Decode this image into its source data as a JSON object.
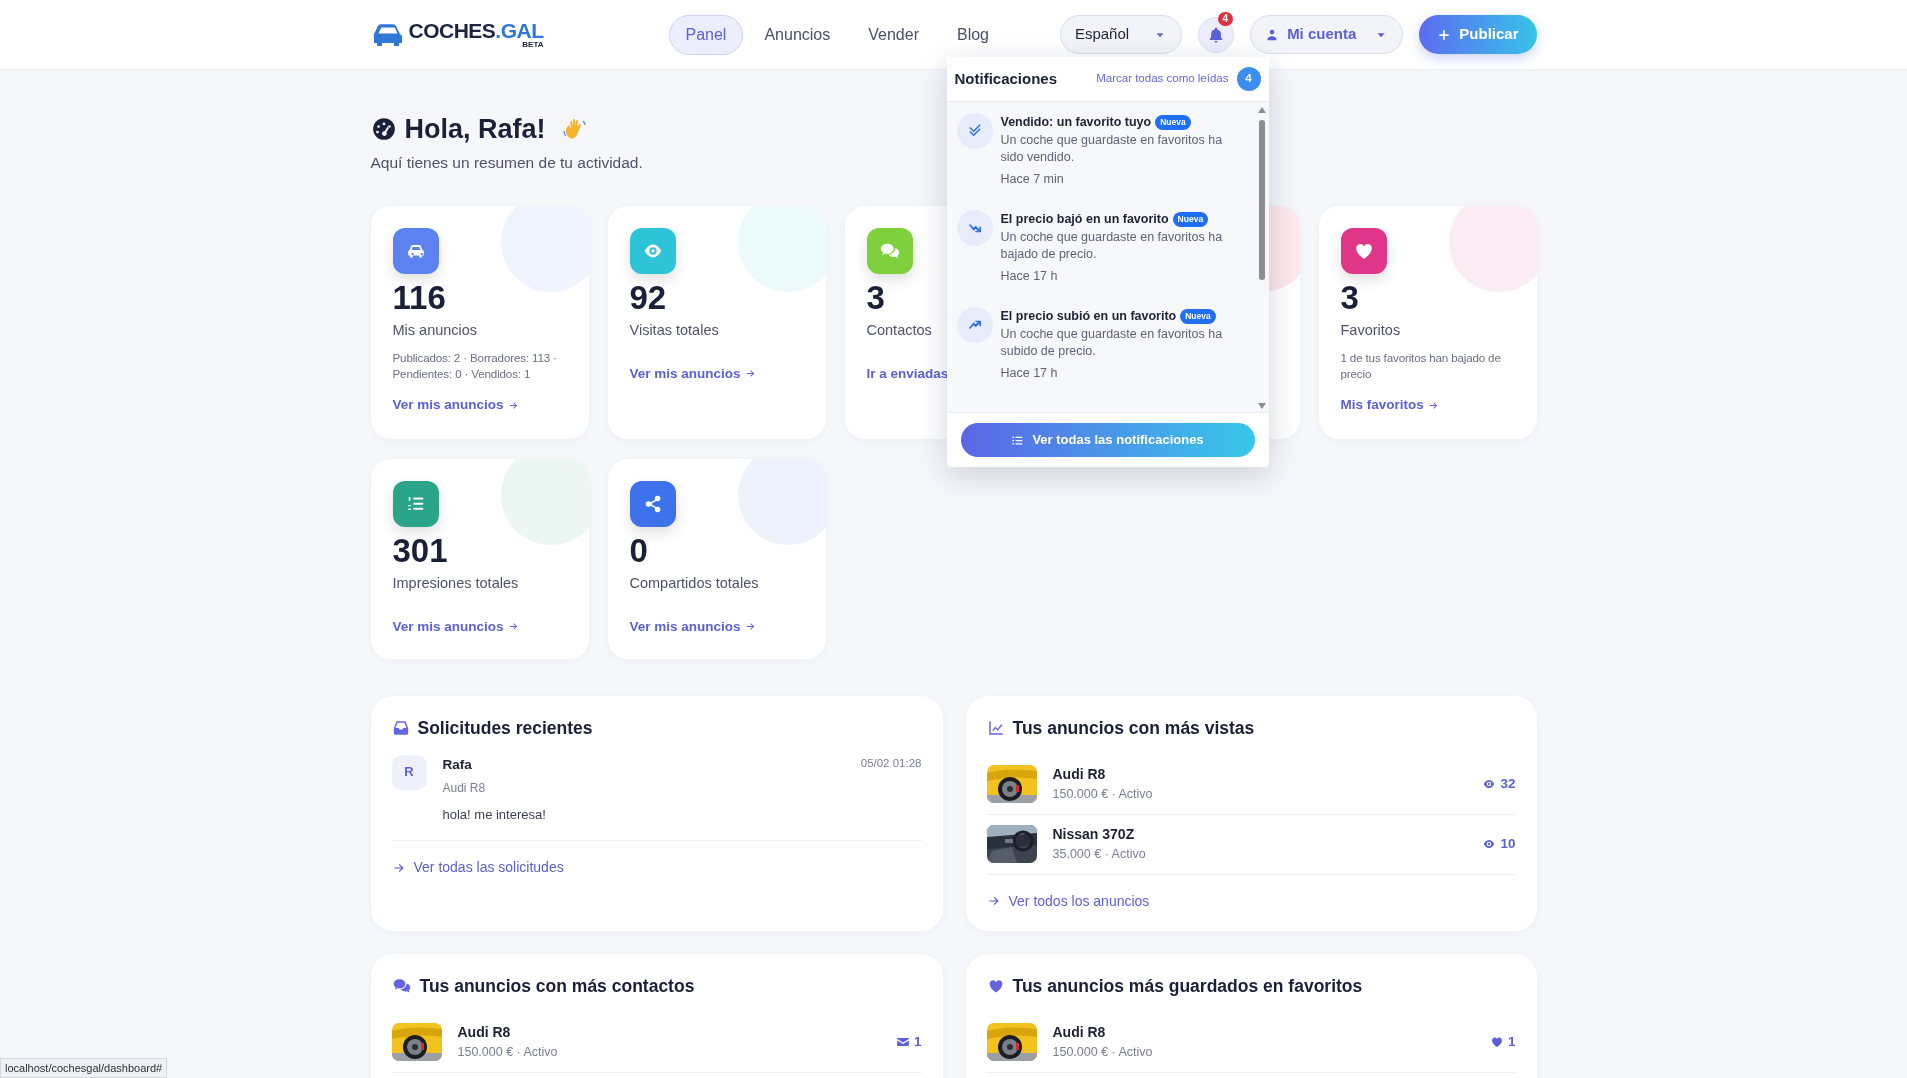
{
  "brand": {
    "text": "COCHES",
    "accent": ".GAL",
    "tag": "BETA"
  },
  "nav": [
    {
      "label": "Panel",
      "selected": true
    },
    {
      "label": "Anuncios",
      "selected": false
    },
    {
      "label": "Vender",
      "selected": false
    },
    {
      "label": "Blog",
      "selected": false
    }
  ],
  "language": "Español",
  "notification_count": "4",
  "account": "Mi cuenta",
  "publish": "Publicar",
  "notifications": {
    "title": "Notificaciones",
    "mark_all": "Marcar todas como leídas",
    "count": "4",
    "items": [
      {
        "kind": "sold",
        "title": "Vendido: un favorito tuyo",
        "badge": "Nueva",
        "text": "Un coche que guardaste en favoritos ha sido vendido.",
        "time": "Hace 7 min"
      },
      {
        "kind": "down",
        "title": "El precio bajó en un favorito",
        "badge": "Nueva",
        "text": "Un coche que guardaste en favoritos ha bajado de precio.",
        "time": "Hace 17 h"
      },
      {
        "kind": "up",
        "title": "El precio subió en un favorito",
        "badge": "Nueva",
        "text": "Un coche que guardaste en favoritos ha subido de precio.",
        "time": "Hace 17 h"
      }
    ],
    "view_all": "Ver todas las notificaciones"
  },
  "greeting": {
    "title": "Hola, Rafa!",
    "subtitle": "Aquí tienes un resumen de tu actividad."
  },
  "stats": [
    {
      "kind": "car",
      "color": "#5b82f0",
      "value": "116",
      "label": "Mis anuncios",
      "detail": "Publicados: 2 · Borradores: 113 · Pendientes: 0 · Vendidos: 1",
      "link": "Ver mis anuncios"
    },
    {
      "kind": "eye",
      "color": "#2ec4d8",
      "value": "92",
      "label": "Visitas totales",
      "link": "Ver mis anuncios"
    },
    {
      "kind": "chat",
      "color": "#7ed03c",
      "value": "3",
      "label": "Contactos",
      "link": "Ir a enviadas"
    },
    {
      "kind": "covered",
      "color": "#fde8ec"
    },
    {
      "kind": "heart",
      "color": "#e0368a",
      "value": "3",
      "label": "Favoritos",
      "detail": "1 de tus favoritos han bajado de precio",
      "link": "Mis favoritos"
    },
    {
      "kind": "list",
      "color": "#2aa58a",
      "value": "301",
      "label": "Impresiones totales",
      "link": "Ver mis anuncios"
    },
    {
      "kind": "share",
      "color": "#3d72ea",
      "value": "0",
      "label": "Compartidos totales",
      "link": "Ver mis anuncios"
    }
  ],
  "requests": {
    "title": "Solicitudes recientes",
    "items": [
      {
        "initial": "R",
        "name": "Rafa",
        "car": "Audi R8",
        "message": "hola! me interesa!",
        "date": "05/02 01:28"
      }
    ],
    "link": "Ver todas las solicitudes"
  },
  "most_viewed": {
    "title": "Tus anuncios con más vistas",
    "items": [
      {
        "kind": "exterior",
        "name": "Audi R8",
        "meta": "150.000 € · Activo",
        "count": "32"
      },
      {
        "kind": "interior",
        "name": "Nissan 370Z",
        "meta": "35.000 € · Activo",
        "count": "10"
      }
    ],
    "link": "Ver todos los anuncios"
  },
  "most_contacted": {
    "title": "Tus anuncios con más contactos",
    "items": [
      {
        "kind": "exterior",
        "name": "Audi R8",
        "meta": "150.000 € · Activo",
        "count": "1"
      }
    ]
  },
  "most_favorited": {
    "title": "Tus anuncios más guardados en favoritos",
    "items": [
      {
        "kind": "exterior",
        "name": "Audi R8",
        "meta": "150.000 € · Activo",
        "count": "1"
      }
    ]
  },
  "status_bar": "localhost/cochesgal/dashboard#"
}
